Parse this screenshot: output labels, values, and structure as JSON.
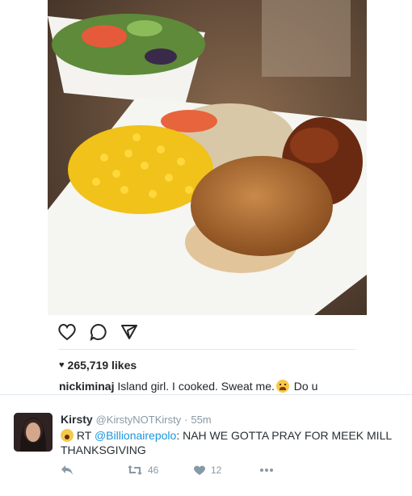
{
  "instagram": {
    "likes_count": "265,719 likes",
    "caption_user": "nickiminaj",
    "caption_text": "Island girl. I cooked. Sweat me.",
    "caption_tail": "Do u"
  },
  "tweet": {
    "name": "Kirsty",
    "handle": "@KirstyNOTKirsty",
    "separator": "·",
    "time": "55m",
    "text_prefix": "RT",
    "mention": "@Billionairepolo",
    "text_body": ": NAH WE GOTTA PRAY FOR MEEK MILL THANKSGIVING",
    "retweet_count": "46",
    "like_count": "12"
  },
  "colors": {
    "link": "#1b95e0",
    "muted": "#8899a6"
  },
  "icons": [
    "heart-outline-icon",
    "comment-icon",
    "share-icon",
    "heart-icon",
    "reply-icon",
    "retweet-icon",
    "like-heart-icon",
    "more-icon"
  ]
}
